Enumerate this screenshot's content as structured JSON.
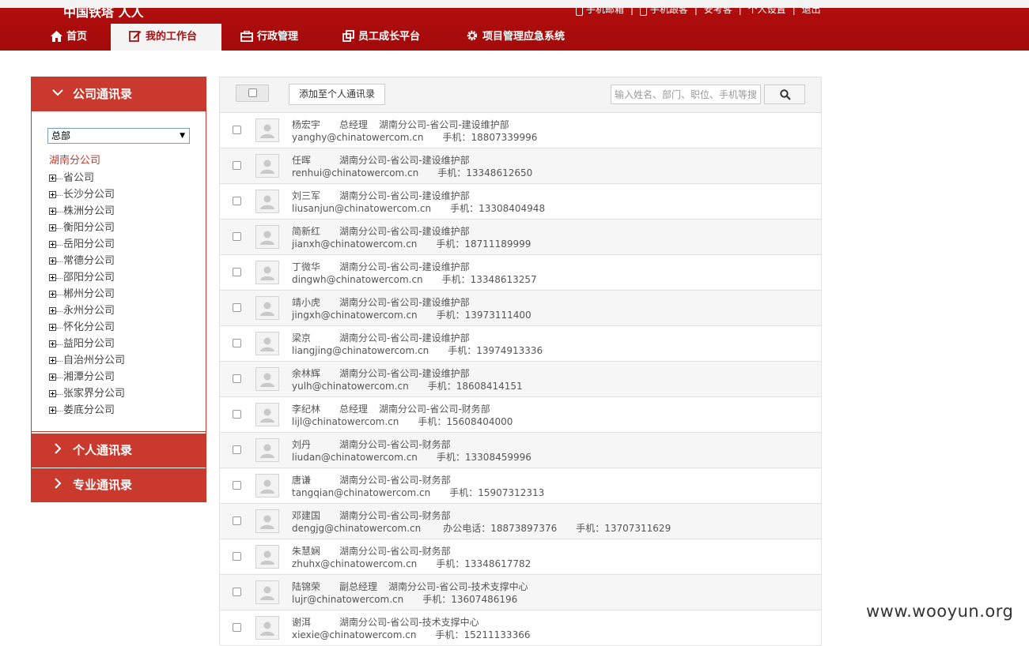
{
  "window": {
    "title_fragment": ""
  },
  "header": {
    "brand": "中国铁塔 人人",
    "top_links": [
      "手机邮箱",
      "手机跟客",
      "安考客",
      "个人设置",
      "退出"
    ],
    "nav": [
      {
        "label": "首页",
        "icon": "home-icon",
        "active": false
      },
      {
        "label": "我的工作台",
        "icon": "edit-icon",
        "active": true
      },
      {
        "label": "行政管理",
        "icon": "briefcase-icon",
        "active": false
      },
      {
        "label": "员工成长平台",
        "icon": "external-link-icon",
        "active": false
      },
      {
        "label": "项目管理应急系统",
        "icon": "gear-icon",
        "active": false
      }
    ]
  },
  "sidebar": {
    "company_label": "公司通讯录",
    "personal_label": "个人通讯录",
    "professional_label": "专业通讯录",
    "select_value": "总部",
    "tree_root": "湖南分公司",
    "tree_nodes": [
      "省公司",
      "长沙分公司",
      "株洲分公司",
      "衡阳分公司",
      "岳阳分公司",
      "常德分公司",
      "邵阳分公司",
      "郴州分公司",
      "永州分公司",
      "怀化分公司",
      "益阳分公司",
      "自治州分公司",
      "湘潭分公司",
      "张家界分公司",
      "娄底分公司"
    ]
  },
  "toolbar": {
    "add_label": "添加至个人通讯录",
    "search_placeholder": "输入姓名、部门、职位、手机等搜索"
  },
  "contacts": [
    {
      "name": "杨宏宇",
      "title": "总经理",
      "dept": "湖南分公司-省公司-建设维护部",
      "email": "yanghy@chinatowercom.cn",
      "office": "",
      "mobile": "手机：18807339996"
    },
    {
      "name": "任晖",
      "title": "",
      "dept": "湖南分公司-省公司-建设维护部",
      "email": "renhui@chinatowercom.cn",
      "office": "",
      "mobile": "手机：13348612650"
    },
    {
      "name": "刘三军",
      "title": "",
      "dept": "湖南分公司-省公司-建设维护部",
      "email": "liusanjun@chinatowercom.cn",
      "office": "",
      "mobile": "手机：13308404948"
    },
    {
      "name": "简新红",
      "title": "",
      "dept": "湖南分公司-省公司-建设维护部",
      "email": "jianxh@chinatowercom.cn",
      "office": "",
      "mobile": "手机：18711189999"
    },
    {
      "name": "丁微华",
      "title": "",
      "dept": "湖南分公司-省公司-建设维护部",
      "email": "dingwh@chinatowercom.cn",
      "office": "",
      "mobile": "手机：13348613257"
    },
    {
      "name": "靖小虎",
      "title": "",
      "dept": "湖南分公司-省公司-建设维护部",
      "email": "jingxh@chinatowercom.cn",
      "office": "",
      "mobile": "手机：13973111400"
    },
    {
      "name": "梁京",
      "title": "",
      "dept": "湖南分公司-省公司-建设维护部",
      "email": "liangjing@chinatowercom.cn",
      "office": "",
      "mobile": "手机：13974913336"
    },
    {
      "name": "余林辉",
      "title": "",
      "dept": "湖南分公司-省公司-建设维护部",
      "email": "yulh@chinatowercom.cn",
      "office": "",
      "mobile": "手机：18608414151"
    },
    {
      "name": "李纪林",
      "title": "总经理",
      "dept": "湖南分公司-省公司-财务部",
      "email": "lijl@chinatowercom.cn",
      "office": "",
      "mobile": "手机：15608404000"
    },
    {
      "name": "刘丹",
      "title": "",
      "dept": "湖南分公司-省公司-财务部",
      "email": "liudan@chinatowercom.cn",
      "office": "",
      "mobile": "手机：13308459996"
    },
    {
      "name": "唐谦",
      "title": "",
      "dept": "湖南分公司-省公司-财务部",
      "email": "tangqian@chinatowercom.cn",
      "office": "",
      "mobile": "手机：15907312313"
    },
    {
      "name": "邓建国",
      "title": "",
      "dept": "湖南分公司-省公司-财务部",
      "email": "dengjg@chinatowercom.cn",
      "office": "办公电话：18873897376",
      "mobile": "手机：13707311629"
    },
    {
      "name": "朱慧娴",
      "title": "",
      "dept": "湖南分公司-省公司-财务部",
      "email": "zhuhx@chinatowercom.cn",
      "office": "",
      "mobile": "手机：13348617782"
    },
    {
      "name": "陆锦荣",
      "title": "副总经理",
      "dept": "湖南分公司-省公司-技术支撑中心",
      "email": "lujr@chinatowercom.cn",
      "office": "",
      "mobile": "手机：13607486196"
    },
    {
      "name": "谢洱",
      "title": "",
      "dept": "湖南分公司-省公司-技术支撑中心",
      "email": "xiexie@chinatowercom.cn",
      "office": "",
      "mobile": "手机：15211133366"
    }
  ],
  "watermark": "www.wooyun.org",
  "colors": {
    "brand_red": "#a30a0a",
    "accordion_red": "#c9392d",
    "active_tree": "#c0392b"
  }
}
